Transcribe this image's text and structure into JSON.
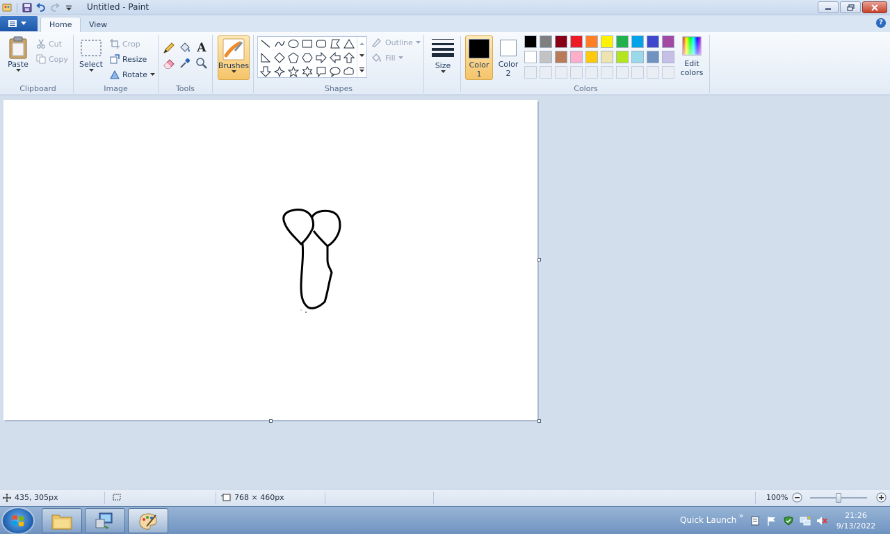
{
  "window": {
    "title": "Untitled - Paint"
  },
  "tabs": {
    "file": "",
    "home": "Home",
    "view": "View"
  },
  "clipboard": {
    "group": "Clipboard",
    "paste": "Paste",
    "cut": "Cut",
    "copy": "Copy"
  },
  "image": {
    "group": "Image",
    "select": "Select",
    "crop": "Crop",
    "resize": "Resize",
    "rotate": "Rotate"
  },
  "tools": {
    "group": "Tools",
    "text": "A"
  },
  "brushes": {
    "label": "Brushes"
  },
  "shapes": {
    "group": "Shapes",
    "outline": "Outline",
    "fill": "Fill"
  },
  "size": {
    "label": "Size"
  },
  "colors": {
    "group": "Colors",
    "color1_line1": "Color",
    "color1_line2": "1",
    "color2_line1": "Color",
    "color2_line2": "2",
    "edit_line1": "Edit",
    "edit_line2": "colors",
    "color1_value": "#000000",
    "color2_value": "#ffffff",
    "palette_row1": [
      "#000000",
      "#7f7f7f",
      "#880015",
      "#ed1c24",
      "#ff7f27",
      "#fff200",
      "#22b14c",
      "#00a2e8",
      "#3f48cc",
      "#a349a4"
    ],
    "palette_row2": [
      "#ffffff",
      "#c3c3c3",
      "#b97a57",
      "#ffaec9",
      "#ffc90e",
      "#efe4b0",
      "#b5e61d",
      "#99d9ea",
      "#7092be",
      "#c8bfe7"
    ]
  },
  "status": {
    "cursor_pos": "435, 305px",
    "canvas_size": "768 × 460px",
    "zoom": "100%"
  },
  "taskbar": {
    "quick_launch": "Quick Launch",
    "time": "21:26",
    "date": "9/13/2022"
  }
}
